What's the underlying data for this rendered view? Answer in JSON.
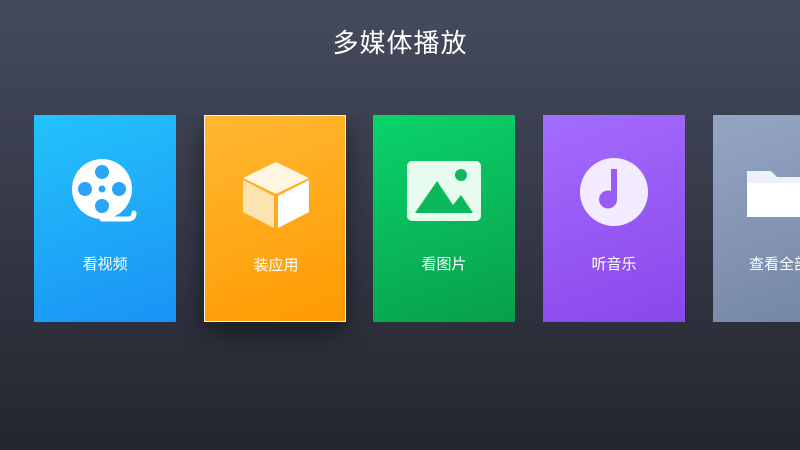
{
  "header": {
    "title": "多媒体播放"
  },
  "tiles": [
    {
      "label": "看视频",
      "icon": "film-reel-icon",
      "color": "#1a92f5"
    },
    {
      "label": "装应用",
      "icon": "box-icon",
      "color": "#ff9a00",
      "focused": true
    },
    {
      "label": "看图片",
      "icon": "picture-icon",
      "color": "#089f4a"
    },
    {
      "label": "听音乐",
      "icon": "music-disc-icon",
      "color": "#8a47ea"
    },
    {
      "label": "查看全部",
      "icon": "folder-icon",
      "color": "#7385a4"
    }
  ]
}
